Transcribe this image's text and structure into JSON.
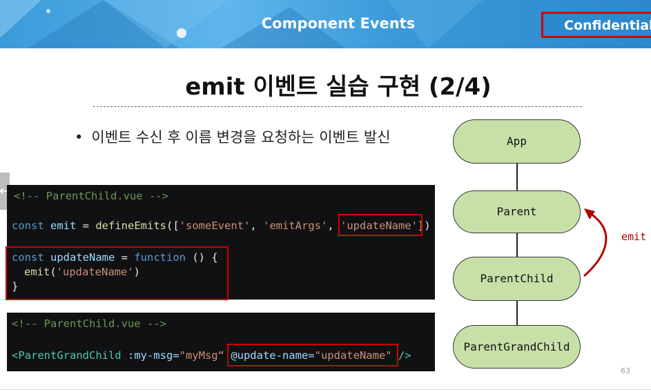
{
  "banner": {
    "title": "Component Events",
    "confidential": "Confidential"
  },
  "slide": {
    "heading": "emit 이벤트 실습 구현 (2/4)",
    "bullet": "이벤트 수신 후 이름 변경을 요청하는 이벤트 발신",
    "page_number": "63"
  },
  "code_block_1": {
    "comment": "<!-- ParentChild.vue -->",
    "line1": {
      "kw": "const",
      "id": "emit",
      "eq": " = ",
      "fn": "defineEmits",
      "open": "([",
      "s1": "'someEvent'",
      "sep1": ", ",
      "s2": "'emitArgs'",
      "sep2": ", ",
      "s3": "'updateName'",
      "close": "])"
    },
    "line2": {
      "kw": "const",
      "id": "updateName",
      "eq": " = ",
      "kw2": "function",
      "rest": " () {"
    },
    "line3": {
      "fn": "emit",
      "open": "(",
      "str": "'updateName'",
      "close": ")"
    },
    "line4": "}"
  },
  "code_block_2": {
    "comment": "<!-- ParentChild.vue -->",
    "tag_open": "<ParentGrandChild",
    "attr1": ":my-msg=",
    "val1": "\"myMsg“",
    "attr2": "@update-name=",
    "val2": "\"updateName\"",
    "tag_close": "/>"
  },
  "diagram": {
    "nodes": [
      "App",
      "Parent",
      "ParentChild",
      "ParentGrandChild"
    ],
    "emit_label": "emit",
    "accent_color": "#c7e0a8",
    "arrow_color": "#b00000"
  },
  "nav": {
    "prev_icon": "←"
  }
}
